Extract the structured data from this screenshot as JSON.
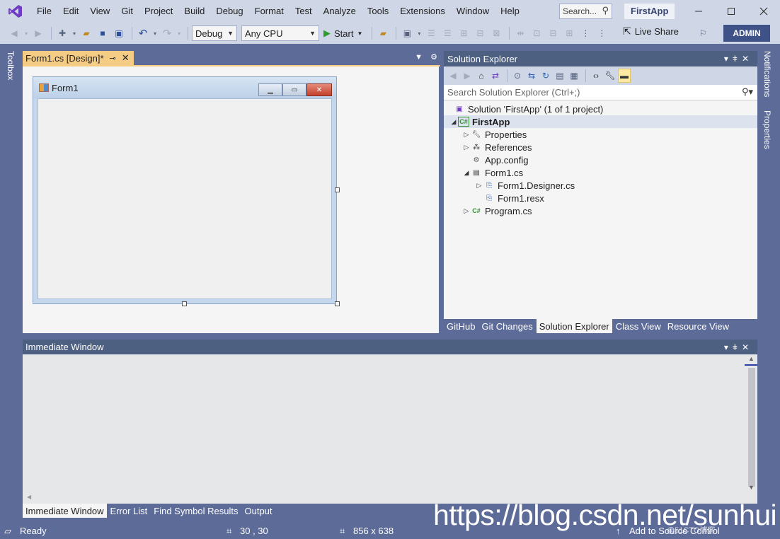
{
  "menubar": {
    "items": [
      "File",
      "Edit",
      "View",
      "Git",
      "Project",
      "Build",
      "Debug",
      "Format",
      "Test",
      "Analyze",
      "Tools",
      "Extensions",
      "Window",
      "Help"
    ],
    "search_placeholder": "Search...",
    "app_title": "FirstApp"
  },
  "toolbar": {
    "config": "Debug",
    "platform": "Any CPU",
    "start_label": "Start",
    "live_share_label": "Live Share",
    "admin_label": "ADMIN"
  },
  "rails": {
    "left": "Toolbox",
    "right_top": "Notifications",
    "right_bottom": "Properties"
  },
  "document": {
    "tab_title": "Form1.cs [Design]*",
    "form_title": "Form1"
  },
  "solution_explorer": {
    "title": "Solution Explorer",
    "search_placeholder": "Search Solution Explorer (Ctrl+;)",
    "tree": [
      {
        "label": "Solution 'FirstApp' (1 of 1 project)",
        "icon": "solution-icon",
        "expander": ""
      },
      {
        "label": "FirstApp",
        "icon": "csharp-project-icon",
        "expander": "▲"
      },
      {
        "label": "Properties",
        "icon": "wrench-icon",
        "expander": "▷"
      },
      {
        "label": "References",
        "icon": "references-icon",
        "expander": "▷"
      },
      {
        "label": "App.config",
        "icon": "config-file-icon",
        "expander": ""
      },
      {
        "label": "Form1.cs",
        "icon": "form-icon",
        "expander": "◢"
      },
      {
        "label": "Form1.Designer.cs",
        "icon": "designer-file-icon",
        "expander": "▷"
      },
      {
        "label": "Form1.resx",
        "icon": "resx-file-icon",
        "expander": ""
      },
      {
        "label": "Program.cs",
        "icon": "csharp-file-icon",
        "expander": "▷"
      }
    ],
    "bottom_tabs": [
      "GitHub",
      "Git Changes",
      "Solution Explorer",
      "Class View",
      "Resource View"
    ],
    "active_tab": "Solution Explorer"
  },
  "immediate_window": {
    "title": "Immediate Window",
    "bottom_tabs": [
      "Immediate Window",
      "Error List",
      "Find Symbol Results",
      "Output"
    ],
    "active_tab": "Immediate Window"
  },
  "statusbar": {
    "ready": "Ready",
    "position": "30 , 30",
    "size": "856 x 638",
    "source_control": "Add to Source Control"
  },
  "watermark": {
    "url": "https://blog.csdn.net/sunhui",
    "small": "@51CTO博客"
  },
  "colors": {
    "chrome": "#cfd6e5",
    "frame": "#5d6b99",
    "tool_title": "#4d6082",
    "doc_tab": "#f5cc84",
    "admin": "#3e5288"
  }
}
